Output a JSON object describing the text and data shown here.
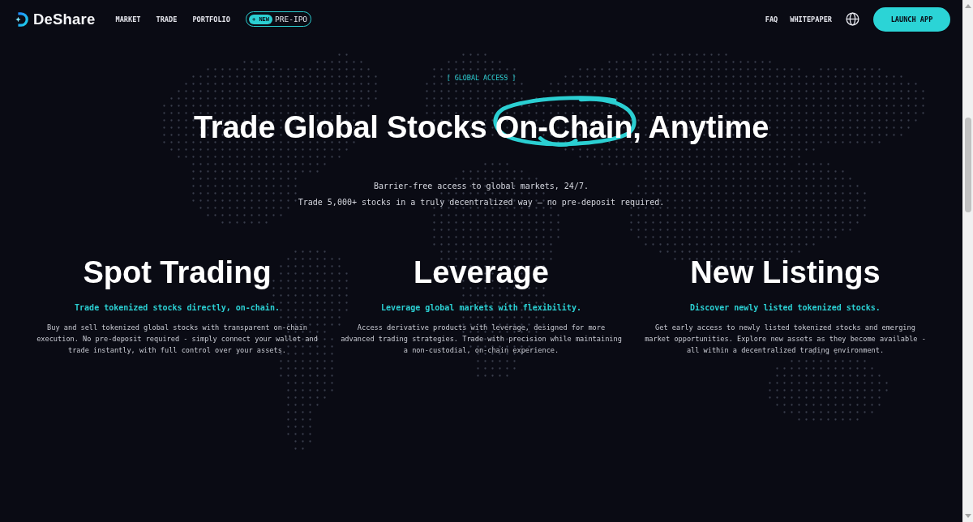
{
  "nav": {
    "brand": "DeShare",
    "links": [
      {
        "label": "MARKET"
      },
      {
        "label": "TRADE"
      },
      {
        "label": "PORTFOLIO"
      }
    ],
    "badge_link": {
      "tag": "+ NEW",
      "label": "PRE-IPO"
    },
    "right_links": [
      {
        "label": "FAQ"
      },
      {
        "label": "WHITEPAPER"
      }
    ],
    "cta": "LAUNCH APP"
  },
  "hero": {
    "eyebrow": "[ GLOBAL ACCESS ]",
    "title_before": "Trade Global Stocks ",
    "title_circled": "On-Chain",
    "title_after": ", Anytime",
    "lines": [
      "Barrier-free access to global markets, 24/7.",
      "Trade 5,000+ stocks in a truly decentralized way – no pre-deposit required."
    ]
  },
  "features": [
    {
      "title": "Spot Trading",
      "tagline": "Trade tokenized stocks directly, on-chain.",
      "body": "Buy and sell tokenized global stocks with transparent on-chain execution. No pre-deposit required - simply connect your wallet and trade instantly, with full control over your assets."
    },
    {
      "title": "Leverage",
      "tagline": "Leverage global markets with flexibility.",
      "body": "Access derivative products with leverage, designed for more advanced trading strategies. Trade with precision while maintaining a non-custodial, on-chain experience."
    },
    {
      "title": "New Listings",
      "tagline": "Discover newly listed tokenized stocks.",
      "body": "Get early access to newly listed tokenized stocks and emerging market opportunities. Explore new assets as they become available - all within a decentralized trading environment."
    }
  ]
}
